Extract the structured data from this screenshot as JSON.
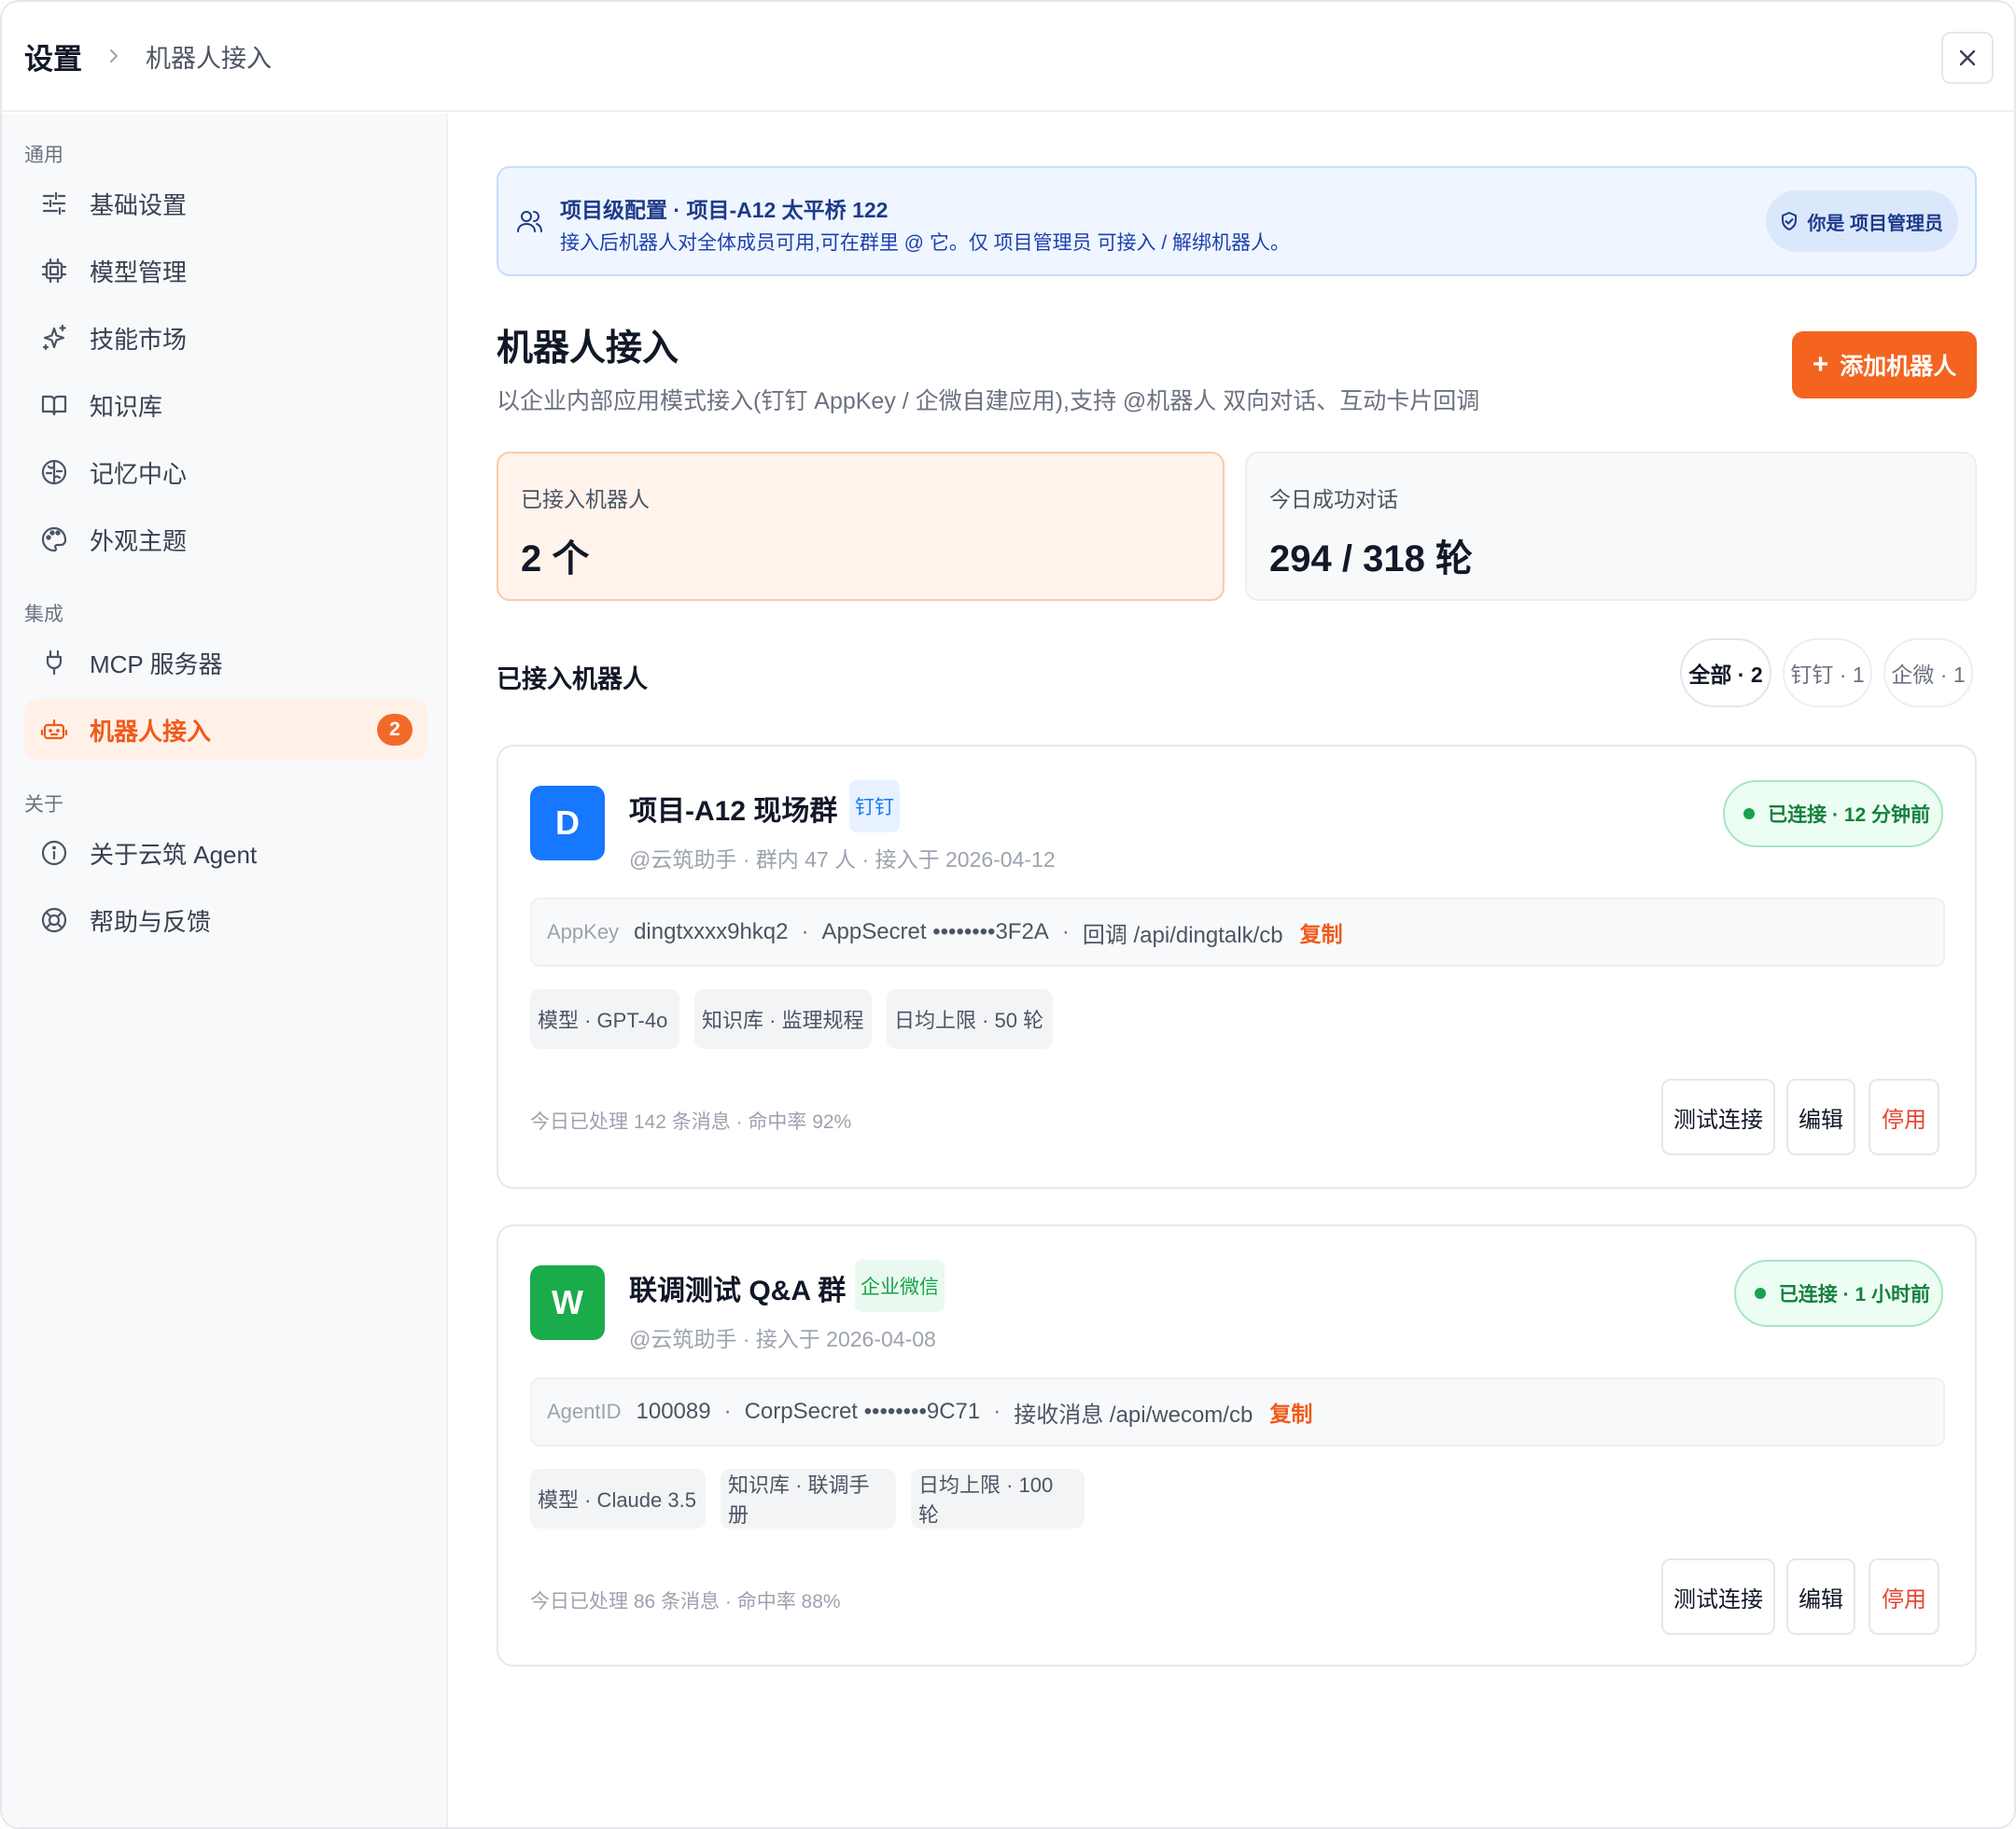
{
  "header": {
    "root": "设置",
    "current": "机器人接入"
  },
  "sidebar": {
    "sections": [
      {
        "label": "通用"
      },
      {
        "label": "集成"
      },
      {
        "label": "关于"
      }
    ],
    "items": [
      {
        "label": "基础设置",
        "icon": "sliders-icon"
      },
      {
        "label": "模型管理",
        "icon": "chip-icon"
      },
      {
        "label": "技能市场",
        "icon": "sparkles-icon"
      },
      {
        "label": "知识库",
        "icon": "book-icon"
      },
      {
        "label": "记忆中心",
        "icon": "brain-icon"
      },
      {
        "label": "外观主题",
        "icon": "palette-icon"
      },
      {
        "label": "MCP 服务器",
        "icon": "plug-icon"
      },
      {
        "label": "机器人接入",
        "icon": "bot-icon",
        "badge": "2",
        "active": true
      },
      {
        "label": "关于云筑 Agent",
        "icon": "info-icon"
      },
      {
        "label": "帮助与反馈",
        "icon": "lifebuoy-icon"
      }
    ]
  },
  "banner": {
    "title": "项目级配置 · 项目-A12 太平桥 122",
    "desc": "接入后机器人对全体成员可用,可在群里 @ 它。仅 项目管理员 可接入 / 解绑机器人。",
    "role": "你是 项目管理员"
  },
  "page": {
    "title": "机器人接入",
    "subtitle": "以企业内部应用模式接入(钉钉 AppKey / 企微自建应用),支持 @机器人 双向对话、互动卡片回调",
    "add_button": "添加机器人",
    "add_plus": "+"
  },
  "stats": [
    {
      "label": "已接入机器人",
      "value": "2 个"
    },
    {
      "label": "今日成功对话",
      "value": "294 / 318 轮"
    }
  ],
  "list": {
    "title": "已接入机器人",
    "filters": [
      {
        "label": "全部 · 2",
        "active": true
      },
      {
        "label": "钉钉 · 1"
      },
      {
        "label": "企微 · 1"
      }
    ]
  },
  "bots": [
    {
      "avatar": "D",
      "avatar_color": "#1677ff",
      "name": "项目-A12 现场群",
      "platform": "钉钉",
      "platform_color": "#1677ff",
      "platform_bg": "#e8f1ff",
      "meta": "@云筑助手 · 群内 47 人 · 接入于 2026-04-12",
      "status": "已连接 · 12 分钟前",
      "cred": [
        {
          "k": "AppKey",
          "v": "dingtxxxx9hkq2"
        },
        {
          "v": "AppSecret ••••••••3F2A"
        },
        {
          "v": "回调 /api/dingtalk/cb"
        }
      ],
      "copy": "复制",
      "chips": [
        "模型 · GPT-4o",
        "知识库 · 监理规程",
        "日均上限 · 50 轮"
      ],
      "foot": "今日已处理 142 条消息 · 命中率 92%",
      "actions": {
        "test": "测试连接",
        "edit": "编辑",
        "disable": "停用"
      }
    },
    {
      "avatar": "W",
      "avatar_color": "#1aab4b",
      "name": "联调测试 Q&A 群",
      "platform": "企业微信",
      "platform_color": "#16a34a",
      "platform_bg": "#e9f9ef",
      "meta": "@云筑助手 · 接入于 2026-04-08",
      "status": "已连接 · 1 小时前",
      "cred": [
        {
          "k": "AgentID",
          "v": "100089"
        },
        {
          "v": "CorpSecret ••••••••9C71"
        },
        {
          "v": "接收消息 /api/wecom/cb"
        }
      ],
      "copy": "复制",
      "chips": [
        "模型 · Claude 3.5",
        "知识库 · 联调手册",
        "日均上限 · 100 轮"
      ],
      "foot": "今日已处理 86 条消息 · 命中率 88%",
      "actions": {
        "test": "测试连接",
        "edit": "编辑",
        "disable": "停用"
      }
    }
  ],
  "colors": {
    "accent": "#f4641f",
    "success": "#16a34a",
    "info": "#1e3a8a"
  }
}
